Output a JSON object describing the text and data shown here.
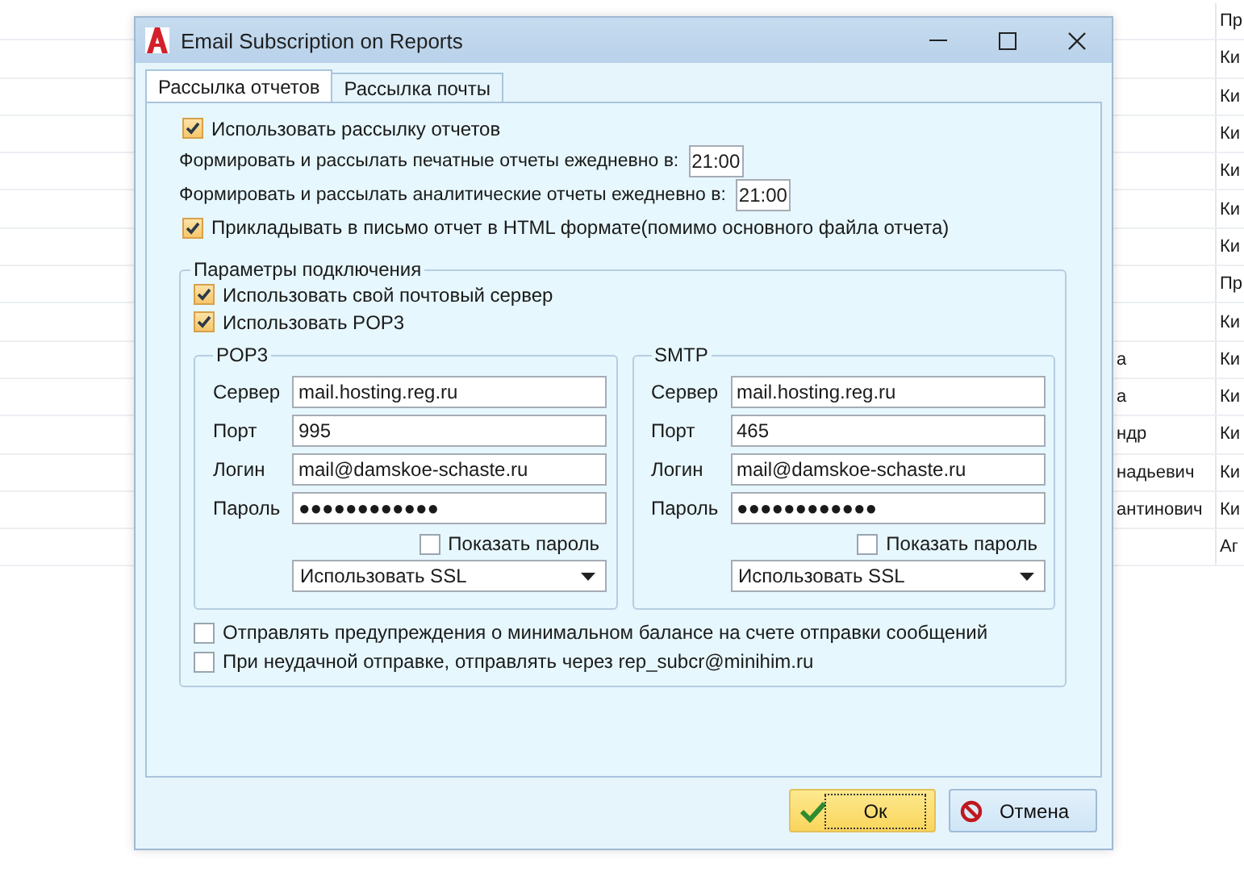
{
  "background_table": {
    "rows": [
      {
        "column_2": "Пр"
      },
      {
        "column_2": "Ки"
      },
      {
        "column_2": "Ки"
      },
      {
        "column_2": "Ки"
      },
      {
        "column_2": "Ки"
      },
      {
        "column_2": "Ки"
      },
      {
        "column_2": "Ки"
      },
      {
        "column_2": "Пр"
      },
      {
        "column_2": "Ки"
      },
      {
        "column_1": "а",
        "column_2": "Ки"
      },
      {
        "column_1": "а",
        "column_2": "Ки"
      },
      {
        "column_1": "ндр",
        "column_2": "Ки"
      },
      {
        "column_1": "надьевич",
        "column_2": "Ки"
      },
      {
        "column_1": "антинович",
        "column_2": "Ки"
      },
      {
        "column_2": "Аг"
      }
    ]
  },
  "window": {
    "title": "Email Subscription on Reports"
  },
  "tabs": [
    {
      "label": "Рассылка отчетов",
      "selected": true
    },
    {
      "label": "Рассылка почты",
      "selected": false
    }
  ],
  "report_settings": {
    "use_mailing": {
      "label": "Использовать рассылку отчетов",
      "checked": true
    },
    "schedules": [
      {
        "label": "Формировать и рассылать печатные отчеты ежедневно в:",
        "value": "21:00"
      },
      {
        "label": "Формировать и рассылать аналитические отчеты ежедневно в:",
        "value": "21:00"
      }
    ],
    "attach_html": {
      "label": "Прикладывать в письмо отчет в HTML формате(помимо основного файла отчета)",
      "checked": true
    }
  },
  "connection": {
    "title": "Параметры подключения",
    "options": [
      {
        "label": "Использовать свой почтовый сервер",
        "checked": true
      },
      {
        "label": "Использовать POP3",
        "checked": true
      }
    ],
    "servers": [
      {
        "title": "POP3",
        "fields": [
          {
            "label": "Сервер",
            "value": "mail.hosting.reg.ru"
          },
          {
            "label": "Порт",
            "value": "995"
          },
          {
            "label": "Логин",
            "value": "mail@damskoe-schaste.ru"
          },
          {
            "label": "Пароль",
            "value": "●●●●●●●●●●●●"
          }
        ],
        "show_password": {
          "label": "Показать пароль",
          "checked": false
        },
        "security": "Использовать SSL"
      },
      {
        "title": "SMTP",
        "fields": [
          {
            "label": "Сервер",
            "value": "mail.hosting.reg.ru"
          },
          {
            "label": "Порт",
            "value": "465"
          },
          {
            "label": "Логин",
            "value": "mail@damskoe-schaste.ru"
          },
          {
            "label": "Пароль",
            "value": "●●●●●●●●●●●●"
          }
        ],
        "show_password": {
          "label": "Показать пароль",
          "checked": false
        },
        "security": "Использовать SSL"
      }
    ],
    "bottom_options": [
      {
        "label": "Отправлять предупреждения о минимальном балансе на счете отправки сообщений",
        "checked": false
      },
      {
        "label": "При неудачной отправке, отправлять через rep_subcr@minihim.ru",
        "checked": false
      }
    ]
  },
  "buttons": [
    {
      "label": "Ок",
      "kind": "ok",
      "focused": true
    },
    {
      "label": "Отмена",
      "kind": "cancel",
      "focused": false
    }
  ]
}
